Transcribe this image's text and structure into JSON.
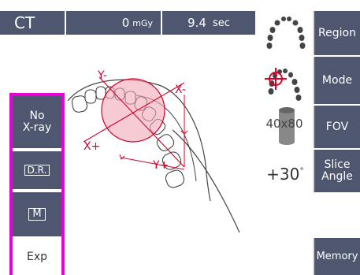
{
  "topbar": {
    "mode": "CT",
    "dose_value": "0",
    "dose_unit": "mGy",
    "time_value": "9.4",
    "time_unit": "sec"
  },
  "right_buttons": {
    "region": "Region",
    "mode": "Mode",
    "fov": "FOV",
    "slice_angle_line1": "Slice",
    "slice_angle_line2": "Angle",
    "memory": "Memory"
  },
  "left_buttons": {
    "no_xray_line1": "No",
    "no_xray_line2": "X-ray",
    "dr": "D.R.",
    "m": "M",
    "exp": "Exp"
  },
  "fov_label": "40x80",
  "slice_angle_value": "+30",
  "slice_angle_unit": "°",
  "diagram_labels": {
    "y_minus": "Y-",
    "x_minus": "X-",
    "x_plus": "X+",
    "y_plus": "Y+"
  },
  "colors": {
    "button_bg": "#4f5770",
    "highlight_border": "#e800d8",
    "fov_circle": "#f1a8b8",
    "axis_red": "#d8002a"
  },
  "icons": [
    "arch-region-icon",
    "arch-mode-target-icon",
    "fov-cylinder-icon"
  ]
}
